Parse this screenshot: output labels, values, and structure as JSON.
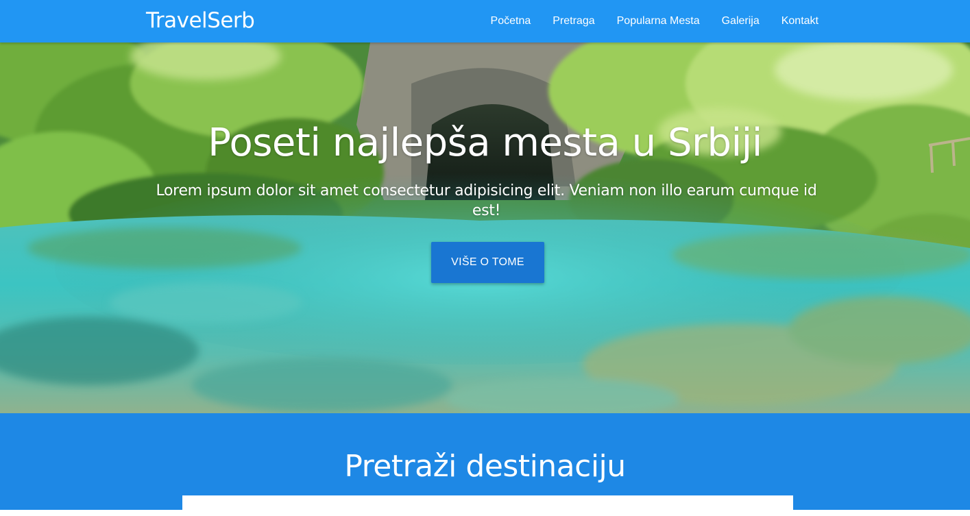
{
  "navbar": {
    "brand": "TravelSerb",
    "links": [
      "Početna",
      "Pretraga",
      "Popularna Mesta",
      "Galerija",
      "Kontakt"
    ],
    "color": "#2196f3"
  },
  "hero": {
    "title": "Poseti najlepša mesta u Srbiji",
    "subtitle": "Lorem ipsum dolor sit amet consectetur adipisicing elit. Veniam non illo earum cumque id est!",
    "button_label": "VIŠE O TOME",
    "button_color": "#1976d2",
    "background_image": "lake-in-forest"
  },
  "search": {
    "title": "Pretraži destinaciju",
    "input_value": "",
    "background_color": "#1e88e5"
  }
}
